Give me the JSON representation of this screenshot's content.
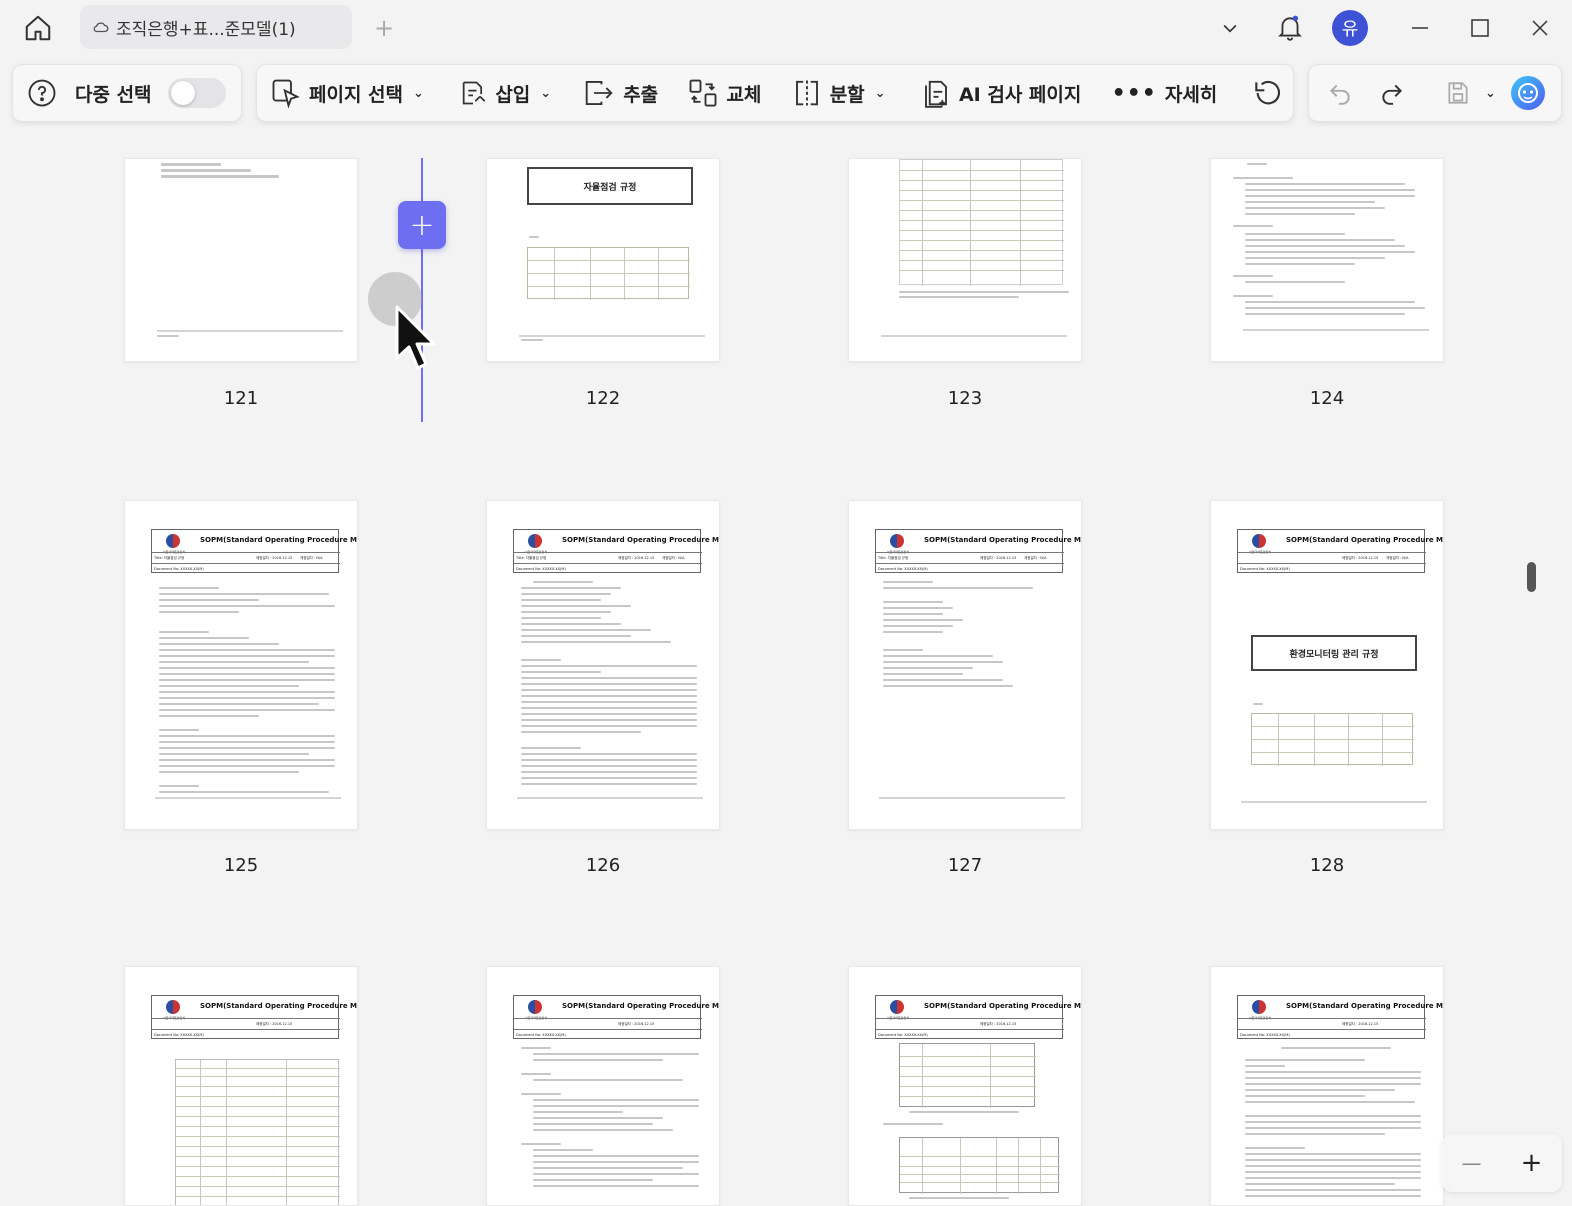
{
  "titlebar": {
    "tab_title": "조직은행+표...준모델(1)",
    "new_tab_symbol": "+",
    "avatar_initial": "유"
  },
  "toolbar": {
    "help_icon": "question-circle-icon",
    "multi_select_label": "다중 선택",
    "page_select_label": "페이지 선택",
    "insert_label": "삽입",
    "extract_label": "추출",
    "replace_label": "교체",
    "split_label": "분할",
    "ai_check_label": "AI 검사 페이지",
    "more_label": "자세히"
  },
  "pages": {
    "p122_title": "자율점검 규정",
    "p128_title": "환경모니터링 관리 규정",
    "sop_title": "SOPM(Standard Operating Procedure Manual)",
    "sop_org": "식품의약품안전처",
    "sop_title_label": "Title: 자율점검 규정",
    "sop_docno_label": "Document No: XXXXX-XX(M)",
    "sop_date_label": "제정일자 : 2016.12.15",
    "sop_rev_label": "개정일자 : N/A",
    "numbers": [
      "121",
      "122",
      "123",
      "124",
      "125",
      "126",
      "127",
      "128"
    ]
  },
  "insert_marker": {
    "symbol": "+"
  },
  "zoom": {
    "minus": "—",
    "plus": "+"
  },
  "colors": {
    "accent": "#6d6ff0",
    "avatar": "#3d52d5"
  }
}
